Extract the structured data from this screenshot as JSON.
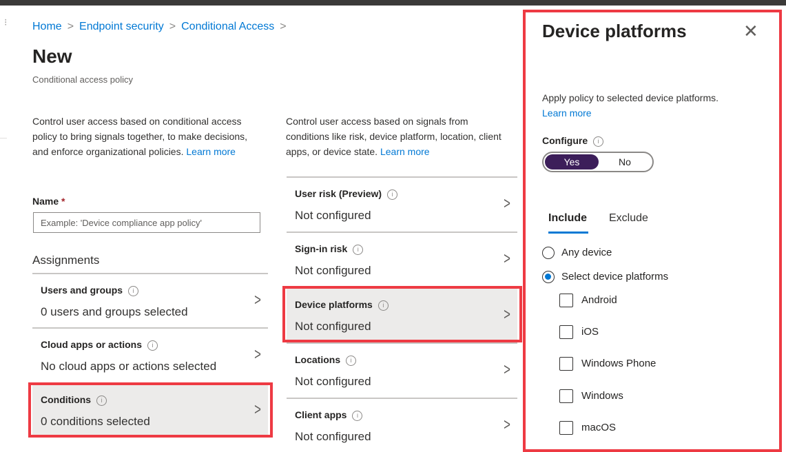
{
  "breadcrumb": {
    "home": "Home",
    "endpoint": "Endpoint security",
    "ca": "Conditional Access",
    "sep": ">"
  },
  "page": {
    "title": "New",
    "subtitle": "Conditional access policy"
  },
  "left_desc": {
    "text": "Control user access based on conditional access policy to bring signals together, to make decisions, and enforce organizational policies.",
    "link": "Learn more"
  },
  "right_desc": {
    "text": "Control user access based on signals from conditions like risk, device platform, location, client apps, or device state.",
    "link": "Learn more"
  },
  "name_field": {
    "label": "Name",
    "required_mark": "*",
    "placeholder": "Example: 'Device compliance app policy'"
  },
  "assignments": {
    "label": "Assignments",
    "rows": [
      {
        "title": "Users and groups",
        "value": "0 users and groups selected"
      },
      {
        "title": "Cloud apps or actions",
        "value": "No cloud apps or actions selected"
      },
      {
        "title": "Conditions",
        "value": "0 conditions selected"
      }
    ]
  },
  "conditions": {
    "rows": [
      {
        "title": "User risk (Preview)",
        "value": "Not configured"
      },
      {
        "title": "Sign-in risk",
        "value": "Not configured"
      },
      {
        "title": "Device platforms",
        "value": "Not configured"
      },
      {
        "title": "Locations",
        "value": "Not configured"
      },
      {
        "title": "Client apps",
        "value": "Not configured"
      }
    ]
  },
  "icons": {
    "info": "i",
    "chevron": ">",
    "close": "✕"
  },
  "panel": {
    "title": "Device platforms",
    "description": "Apply policy to selected device platforms.",
    "learn_more": "Learn more",
    "configure_label": "Configure",
    "toggle": {
      "yes": "Yes",
      "no": "No",
      "selected": "Yes"
    },
    "tabs": {
      "include": "Include",
      "exclude": "Exclude",
      "active": "Include"
    },
    "radios": {
      "any": "Any device",
      "select": "Select device platforms",
      "selected": "select"
    },
    "platforms": [
      "Android",
      "iOS",
      "Windows Phone",
      "Windows",
      "macOS"
    ]
  },
  "colors": {
    "accent": "#0078d4",
    "highlight": "#ee3a43",
    "toggle_on": "#3c1e5a"
  }
}
